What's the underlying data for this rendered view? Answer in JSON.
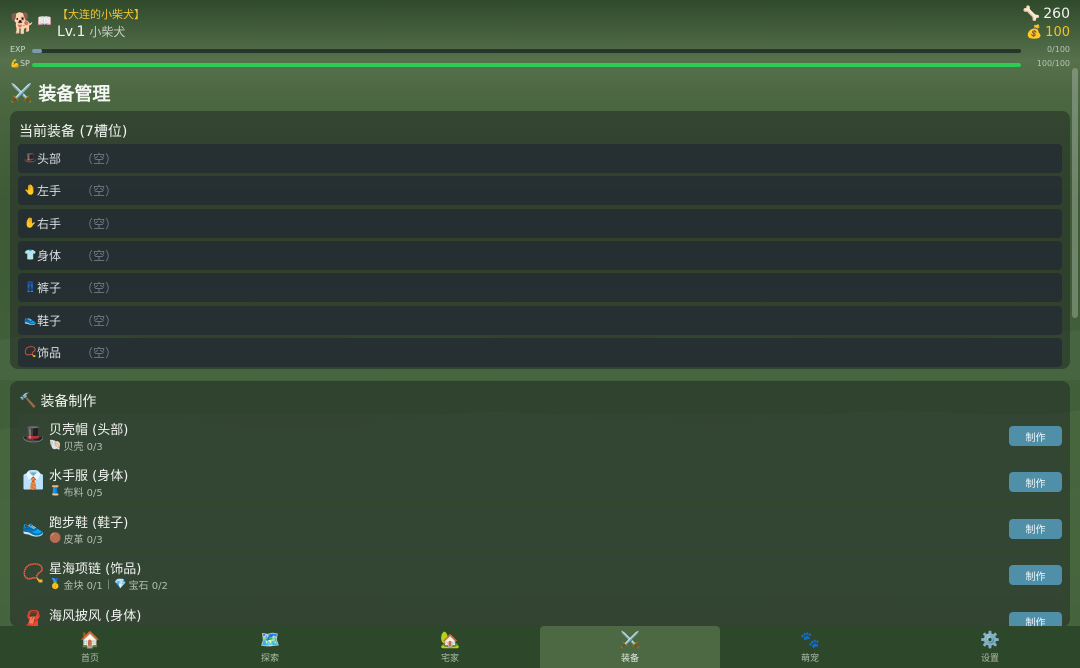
{
  "header": {
    "avatar_icon": "dog-icon",
    "book_icon": "book-icon",
    "pet_name": "【大连的小柴犬】",
    "level": "Lv.1",
    "breed": "小柴犬",
    "bones": "260",
    "coins": "100",
    "exp_label": "EXP",
    "exp_value": "0/100",
    "exp_progress": 0.01,
    "sp_label": "💪SP",
    "sp_value": "100/100",
    "sp_progress": 1.0
  },
  "page": {
    "title": "装备管理",
    "title_icon": "⚔️"
  },
  "current_equipment": {
    "heading": "当前装备 (7槽位)",
    "slots": [
      {
        "icon": "🎩",
        "name": "头部",
        "value": "（空）"
      },
      {
        "icon": "🤚",
        "name": "左手",
        "value": "（空）"
      },
      {
        "icon": "✋",
        "name": "右手",
        "value": "（空）"
      },
      {
        "icon": "👕",
        "name": "身体",
        "value": "（空）"
      },
      {
        "icon": "👖",
        "name": "裤子",
        "value": "（空）"
      },
      {
        "icon": "👟",
        "name": "鞋子",
        "value": "（空）"
      },
      {
        "icon": "📿",
        "name": "饰品",
        "value": "（空）"
      }
    ]
  },
  "crafting": {
    "heading": "装备制作",
    "heading_icon": "🔨",
    "button_label": "制作",
    "items": [
      {
        "icon": "🎩",
        "title": "贝壳帽 (头部)",
        "mats": [
          {
            "icon": "🐚",
            "text": "贝壳 0/3"
          }
        ]
      },
      {
        "icon": "👔",
        "title": "水手服 (身体)",
        "mats": [
          {
            "icon": "🧵",
            "text": "布料 0/5"
          }
        ]
      },
      {
        "icon": "👟",
        "title": "跑步鞋 (鞋子)",
        "mats": [
          {
            "icon": "🟤",
            "text": "皮革 0/3"
          }
        ]
      },
      {
        "icon": "📿",
        "title": "星海项链 (饰品)",
        "mats": [
          {
            "icon": "🥇",
            "text": "金块 0/1"
          },
          {
            "icon": "💎",
            "text": "宝石 0/2"
          }
        ]
      },
      {
        "icon": "🧣",
        "title": "海风披风 (身体)",
        "mats": []
      }
    ]
  },
  "nav": [
    {
      "icon": "🏠",
      "label": "首页"
    },
    {
      "icon": "🗺️",
      "label": "探索"
    },
    {
      "icon": "🏡",
      "label": "宅家"
    },
    {
      "icon": "⚔️",
      "label": "装备"
    },
    {
      "icon": "🐾",
      "label": "萌宠"
    },
    {
      "icon": "⚙️",
      "label": "设置"
    }
  ],
  "colors": {
    "accent_green": "#2ecc55",
    "gold": "#f1c232",
    "button_blue": "#4f8fa8"
  }
}
